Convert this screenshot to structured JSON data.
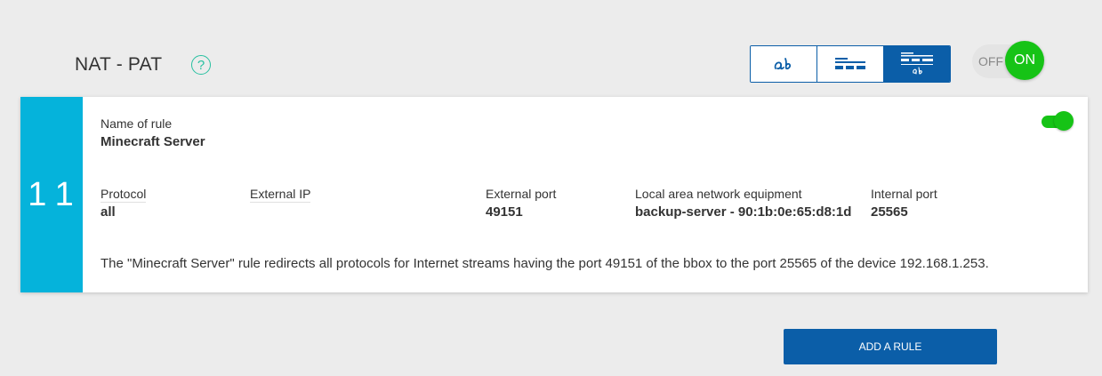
{
  "header": {
    "title": "NAT - PAT",
    "help_icon": "question-circle-icon",
    "help_symbol": "?"
  },
  "view_switch": {
    "options": [
      {
        "name": "text-view",
        "icon": "handwriting-ab-icon",
        "selected": false
      },
      {
        "name": "list-view",
        "icon": "lines-icon",
        "selected": false
      },
      {
        "name": "detailed-view",
        "icon": "lines-with-ab-icon",
        "selected": true
      }
    ]
  },
  "main_toggle": {
    "off_label": "OFF",
    "on_label": "ON",
    "state": "on"
  },
  "rule": {
    "index": "11",
    "name_label": "Name of rule",
    "name_value": "Minecraft Server",
    "enabled": true,
    "protocol_label": "Protocol",
    "protocol_value": "all",
    "external_ip_label": "External IP",
    "external_ip_value": "",
    "external_port_label": "External port",
    "external_port_value": "49151",
    "lan_equipment_label": "Local area network equipment",
    "lan_equipment_value": "backup-server - 90:1b:0e:65:d8:1d",
    "internal_port_label": "Internal port",
    "internal_port_value": "25565",
    "description": "The \"Minecraft Server\" rule redirects all protocols for Internet streams having the port 49151 of the bbox to the port 25565 of the device 192.168.1.253."
  },
  "actions": {
    "add_rule_label": "ADD A RULE"
  },
  "colors": {
    "accent_blue": "#0b5ea8",
    "index_cyan": "#05b3db",
    "toggle_green": "#16c316",
    "help_teal": "#27c0a0"
  }
}
